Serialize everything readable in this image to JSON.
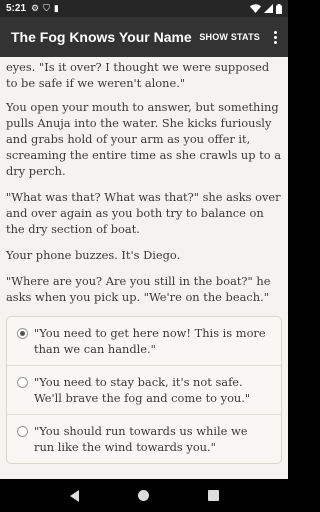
{
  "status_bar": {
    "time": "5:21",
    "icons_left": [
      "gear-icon",
      "shield-icon",
      "sim-icon"
    ],
    "icons_right": [
      "wifi-icon",
      "signal-icon",
      "battery-icon"
    ]
  },
  "app_bar": {
    "title": "The Fog Knows Your Name",
    "show_stats_label": "SHOW STATS",
    "overflow_icon": "more-vert-icon"
  },
  "story": {
    "paragraphs": [
      "eyes. \"Is it over? I thought we were supposed to be safe if we weren't alone.\"",
      "You open your mouth to answer, but something pulls Anuja into the water. She kicks furiously and grabs hold of your arm as you offer it, screaming the entire time as she crawls up to a dry perch.",
      "\"What was that? What was that?\" she asks over and over again as you both try to balance on the dry section of boat.",
      "Your phone buzzes. It's Diego.",
      "\"Where are you? Are you still in the boat?\" he asks when you pick up. \"We're on the beach.\""
    ]
  },
  "choices": [
    {
      "text": "\"You need to get here now! This is more than we can handle.\"",
      "selected": true
    },
    {
      "text": "\"You need to stay back, it's not safe. We'll brave the fog and come to you.\"",
      "selected": false
    },
    {
      "text": "\"You should run towards us while we run like the wind towards you.\"",
      "selected": false
    }
  ],
  "colors": {
    "status_bar": "#262626",
    "app_bar": "#333333",
    "page_background": "#f5f3ef"
  }
}
